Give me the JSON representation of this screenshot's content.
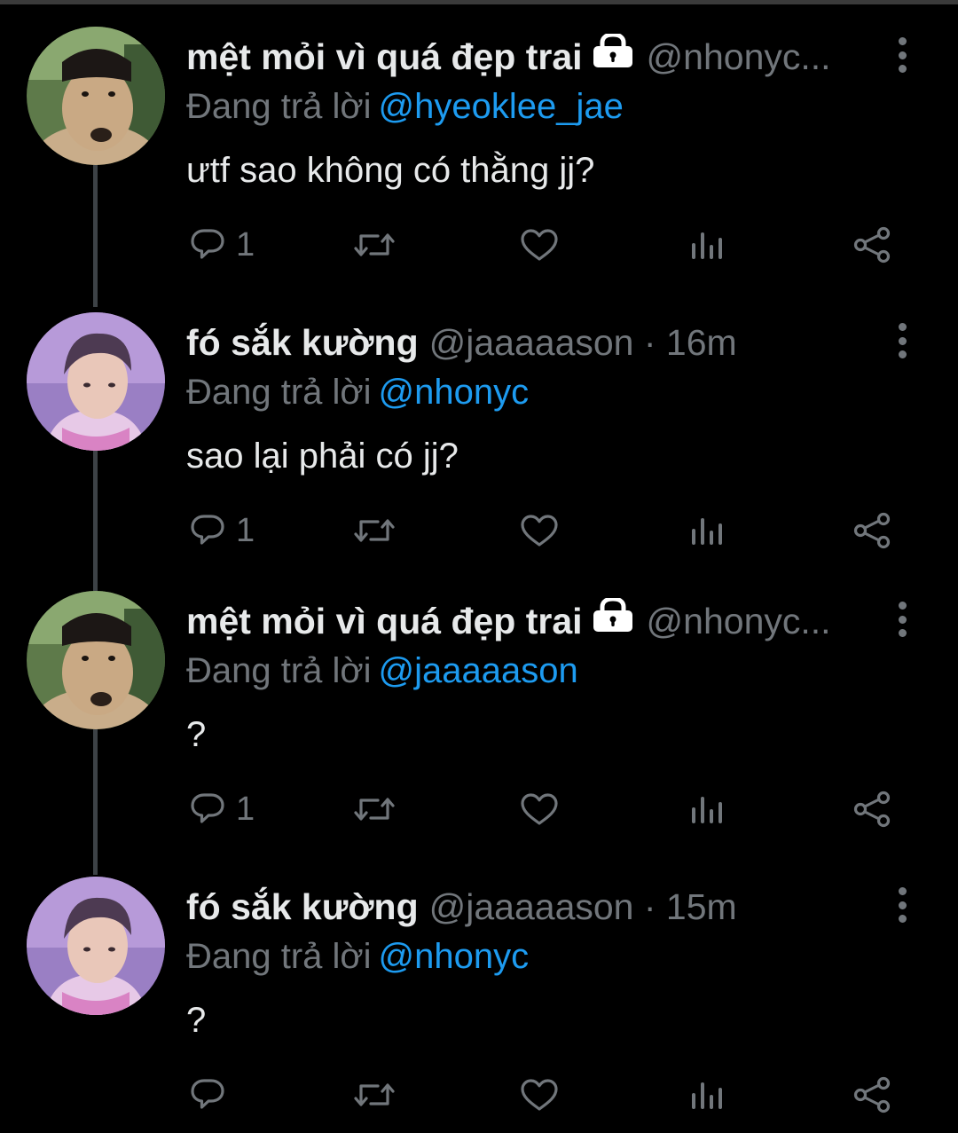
{
  "tweets": [
    {
      "avatar": "dog-wig-avatar",
      "name": "mệt mỏi vì quá đẹp trai",
      "locked": true,
      "handle": "@nhonyc...",
      "time": "",
      "replying_label": "Đang trả lời",
      "replying_to": "@hyeoklee_jae",
      "text": "ưtf sao không có thằng jj?",
      "reply_count": "1"
    },
    {
      "avatar": "boy-avatar",
      "name": "fó sắk kường",
      "locked": false,
      "handle": "@jaaaaason · 16m",
      "time": "16m",
      "replying_label": "Đang trả lời",
      "replying_to": "@nhonyc",
      "text": "sao lại phải có jj?",
      "reply_count": "1"
    },
    {
      "avatar": "dog-wig-avatar",
      "name": "mệt mỏi vì quá đẹp trai",
      "locked": true,
      "handle": "@nhonyc...",
      "time": "",
      "replying_label": "Đang trả lời",
      "replying_to": "@jaaaaason",
      "text": "?",
      "reply_count": "1"
    },
    {
      "avatar": "boy-avatar",
      "name": "fó sắk kường",
      "locked": false,
      "handle": "@jaaaaason · 15m",
      "time": "15m",
      "replying_label": "Đang trả lời",
      "replying_to": "@nhonyc",
      "text": "?",
      "reply_count": ""
    }
  ],
  "icons": {
    "reply": "reply-icon",
    "retweet": "retweet-icon",
    "like": "like-icon",
    "analytics": "analytics-icon",
    "share": "share-icon",
    "more": "more-icon",
    "lock": "lock-icon"
  },
  "colors": {
    "background": "#000000",
    "text": "#e7e9ea",
    "muted": "#71767b",
    "accent": "#1d9bf0",
    "thread_line": "#3d4246"
  }
}
